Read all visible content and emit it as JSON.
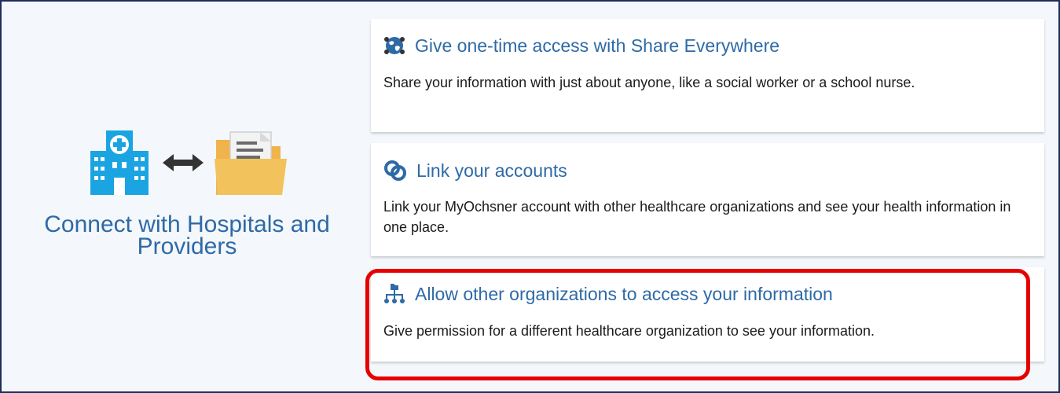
{
  "hero": {
    "title": "Connect with Hospitals and Providers",
    "icons": [
      "hospital-icon",
      "bidirectional-arrow-icon",
      "folder-document-icon"
    ]
  },
  "cards": [
    {
      "icon": "globe-share-icon",
      "title": "Give one-time access with Share Everywhere",
      "description": "Share your information with just about anyone, like a social worker or a school nurse."
    },
    {
      "icon": "link-accounts-icon",
      "title": "Link your accounts",
      "description": "Link your MyOchsner account with other healthcare organizations and see your health information in one place."
    },
    {
      "icon": "organization-hierarchy-icon",
      "title": "Allow other organizations to access your information",
      "description": "Give permission for a different healthcare organization to see your information."
    }
  ],
  "colors": {
    "accent": "#2e6aa6",
    "highlight": "#e60000",
    "background": "#f4f7fb",
    "border": "#1f2f5c"
  }
}
